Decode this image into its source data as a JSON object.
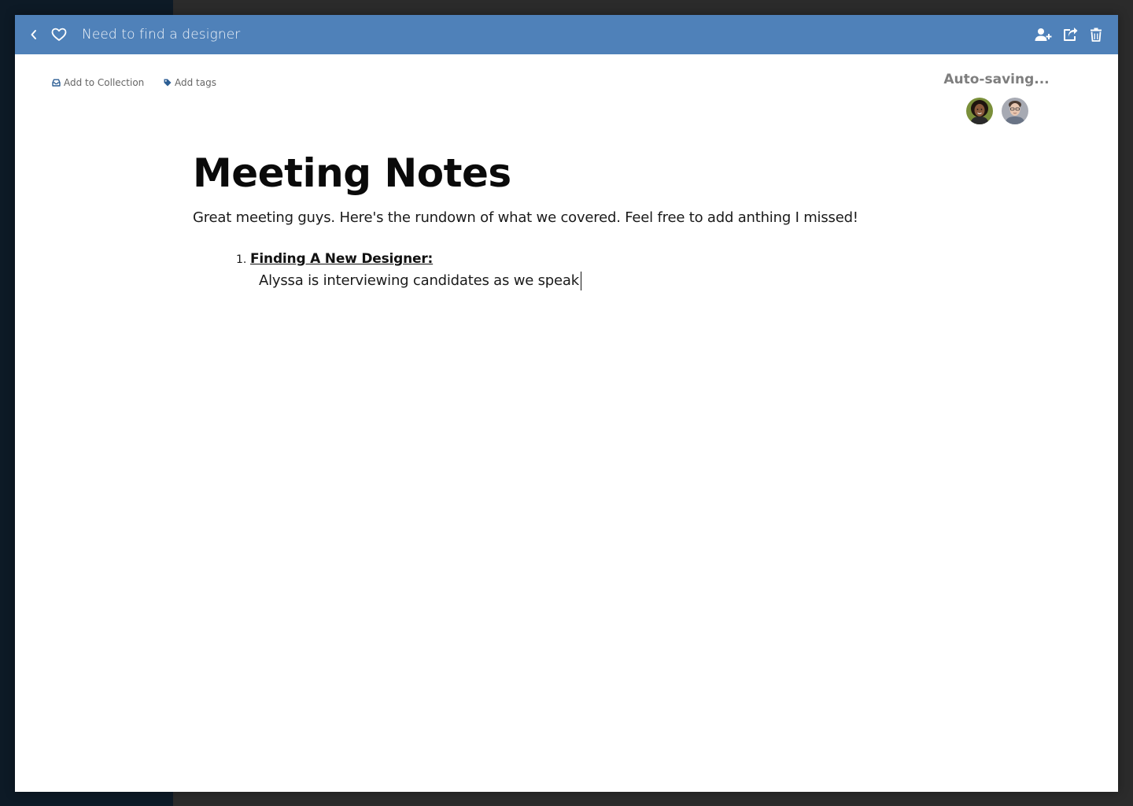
{
  "window": {
    "title": "Need to find a designer"
  },
  "toolbar": {
    "icons": [
      "chevron-left-icon",
      "heart-icon",
      "add-user-icon",
      "share-icon",
      "trash-icon"
    ]
  },
  "meta": {
    "add_to_collection": "Add to Collection",
    "add_tags": "Add tags"
  },
  "status": {
    "autosave": "Auto-saving..."
  },
  "collaborators": [
    {
      "name": "collaborator-1"
    },
    {
      "name": "collaborator-2"
    }
  ],
  "document": {
    "heading": "Meeting Notes",
    "intro": "Great meeting guys. Here's the rundown of what we covered. Feel free to add anthing I missed!",
    "list": [
      {
        "number": "1.",
        "title": "Finding A New Designer:",
        "body": "Alyssa is interviewing candidates as we speak"
      }
    ]
  },
  "colors": {
    "titlebar": "#4f81b9",
    "backdrop": "#2b2b2b",
    "sidebar_backdrop": "#0d1a26",
    "icon_accent": "#2c5e94"
  }
}
